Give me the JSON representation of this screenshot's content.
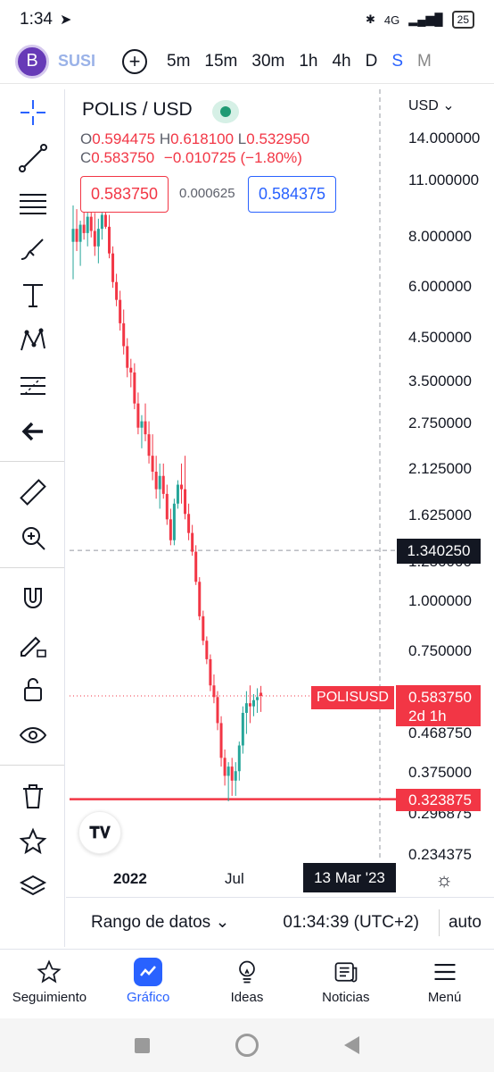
{
  "status_bar": {
    "time": "1:34",
    "network": "4G",
    "battery": "25"
  },
  "toolbar": {
    "avatar_letter": "B",
    "symbol": "SUSI",
    "intervals": [
      {
        "label": "5m",
        "state": "normal"
      },
      {
        "label": "15m",
        "state": "normal"
      },
      {
        "label": "30m",
        "state": "normal"
      },
      {
        "label": "1h",
        "state": "normal"
      },
      {
        "label": "4h",
        "state": "normal"
      },
      {
        "label": "D",
        "state": "normal"
      },
      {
        "label": "S",
        "state": "active"
      },
      {
        "label": "M",
        "state": "faded"
      }
    ]
  },
  "left_tools": [
    "crosshair-icon",
    "trend-line-icon",
    "fib-retracement-icon",
    "brush-icon",
    "text-icon",
    "pattern-icon",
    "forecast-icon",
    "back-arrow-icon",
    "ruler-icon",
    "zoom-in-icon",
    "magnet-icon",
    "lock-drawing-icon",
    "unlock-icon",
    "eye-icon",
    "trash-icon",
    "star-icon",
    "layers-icon"
  ],
  "legend": {
    "title": "POLIS / USD",
    "open_label": "O",
    "open": "0.594475",
    "high_label": "H",
    "high": "0.618100",
    "low_label": "L",
    "low": "0.532950",
    "close_label": "C",
    "close": "0.583750",
    "change": "−0.010725 (−1.80%)",
    "sell": "0.583750",
    "spread": "0.000625",
    "buy": "0.584375"
  },
  "price_axis": {
    "currency": "USD",
    "labels": [
      "14.000000",
      "11.000000",
      "8.000000",
      "6.000000",
      "4.500000",
      "3.500000",
      "2.750000",
      "2.125000",
      "1.625000",
      "1.250000",
      "1.000000",
      "0.750000",
      "0.468750",
      "0.375000",
      "0.296875",
      "0.234375"
    ],
    "crosshair_price": "1.340250",
    "ticker": "POLISUSD",
    "last_price": "0.583750",
    "countdown": "2d 1h",
    "hline_price": "0.323875"
  },
  "time_axis": {
    "labels": [
      "2022",
      "Jul"
    ],
    "crosshair_date": "13 Mar '23"
  },
  "colors": {
    "up": "#26a69a",
    "down": "#f23645",
    "accent": "#2962ff"
  },
  "range_bar": {
    "range_label": "Rango de datos",
    "clock": "01:34:39 (UTC+2)",
    "auto": "auto"
  },
  "bottom_nav": [
    {
      "label": "Seguimiento",
      "icon": "star-icon"
    },
    {
      "label": "Gráfico",
      "icon": "chart-icon"
    },
    {
      "label": "Ideas",
      "icon": "bulb-icon"
    },
    {
      "label": "Noticias",
      "icon": "news-icon"
    },
    {
      "label": "Menú",
      "icon": "hamburger-icon"
    }
  ],
  "chart_data": {
    "type": "candlestick",
    "interval": "S",
    "ylog": true,
    "values": [
      [
        7.8,
        9.6,
        6.3,
        8.4
      ],
      [
        8.4,
        9.4,
        7.4,
        7.8
      ],
      [
        7.8,
        8.8,
        6.8,
        8.6
      ],
      [
        8.6,
        9.3,
        7.9,
        8.2
      ],
      [
        8.2,
        9.6,
        7.6,
        9.0
      ],
      [
        9.0,
        9.9,
        8.0,
        8.3
      ],
      [
        8.3,
        9.2,
        7.2,
        7.6
      ],
      [
        7.6,
        8.9,
        6.9,
        8.4
      ],
      [
        8.4,
        9.5,
        7.9,
        9.1
      ],
      [
        9.1,
        9.7,
        8.4,
        8.5
      ],
      [
        8.5,
        9.1,
        7.1,
        7.3
      ],
      [
        7.3,
        7.6,
        6.0,
        6.2
      ],
      [
        6.2,
        6.5,
        5.4,
        5.6
      ],
      [
        5.6,
        5.9,
        4.7,
        4.9
      ],
      [
        4.9,
        5.3,
        4.1,
        4.3
      ],
      [
        4.3,
        4.5,
        3.6,
        3.8
      ],
      [
        3.8,
        4.0,
        3.4,
        3.7
      ],
      [
        3.7,
        3.9,
        3.0,
        3.1
      ],
      [
        3.1,
        3.3,
        2.6,
        2.7
      ],
      [
        2.7,
        2.9,
        2.4,
        2.8
      ],
      [
        2.8,
        3.1,
        2.5,
        2.6
      ],
      [
        2.6,
        2.8,
        2.2,
        2.3
      ],
      [
        2.3,
        2.6,
        2.0,
        2.1
      ],
      [
        2.1,
        2.3,
        1.8,
        1.9
      ],
      [
        1.9,
        2.2,
        1.7,
        2.05
      ],
      [
        2.05,
        2.2,
        1.8,
        1.85
      ],
      [
        1.85,
        1.95,
        1.55,
        1.6
      ],
      [
        1.6,
        1.7,
        1.38,
        1.42
      ],
      [
        1.42,
        1.8,
        1.38,
        1.75
      ],
      [
        1.75,
        2.0,
        1.7,
        1.95
      ],
      [
        1.95,
        2.2,
        1.75,
        1.9
      ],
      [
        1.9,
        2.3,
        1.6,
        1.65
      ],
      [
        1.65,
        1.75,
        1.42,
        1.48
      ],
      [
        1.48,
        1.55,
        1.3,
        1.33
      ],
      [
        1.33,
        1.38,
        1.1,
        1.12
      ],
      [
        1.12,
        1.15,
        0.9,
        0.92
      ],
      [
        0.92,
        0.95,
        0.78,
        0.8
      ],
      [
        0.8,
        0.82,
        0.7,
        0.72
      ],
      [
        0.72,
        0.74,
        0.6,
        0.62
      ],
      [
        0.62,
        0.66,
        0.56,
        0.58
      ],
      [
        0.58,
        0.6,
        0.48,
        0.5
      ],
      [
        0.5,
        0.52,
        0.39,
        0.41
      ],
      [
        0.41,
        0.43,
        0.35,
        0.37
      ],
      [
        0.37,
        0.4,
        0.32,
        0.39
      ],
      [
        0.39,
        0.41,
        0.33,
        0.36
      ],
      [
        0.36,
        0.4,
        0.33,
        0.38
      ],
      [
        0.38,
        0.45,
        0.36,
        0.44
      ],
      [
        0.44,
        0.55,
        0.42,
        0.53
      ],
      [
        0.53,
        0.6,
        0.47,
        0.56
      ],
      [
        0.56,
        0.62,
        0.5,
        0.55
      ],
      [
        0.55,
        0.59,
        0.52,
        0.57
      ],
      [
        0.57,
        0.61,
        0.53,
        0.58
      ],
      [
        0.594475,
        0.6181,
        0.53295,
        0.58375
      ]
    ],
    "crosshair_y": 1.34025,
    "horizontal_line": 0.323875
  }
}
